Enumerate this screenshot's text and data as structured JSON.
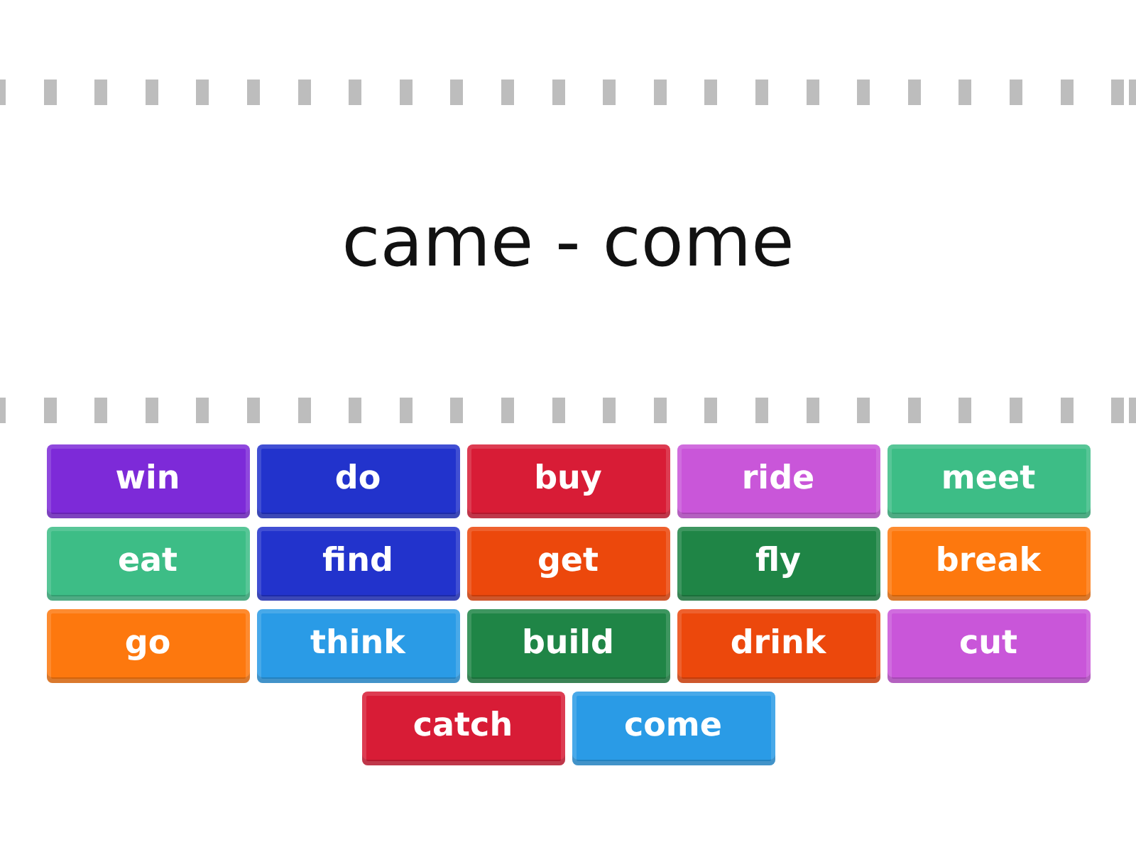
{
  "prompt": {
    "text": "came - come"
  },
  "answers": [
    {
      "label": "win",
      "color": "#7d2ad8"
    },
    {
      "label": "do",
      "color": "#2233cc"
    },
    {
      "label": "buy",
      "color": "#d81c36"
    },
    {
      "label": "ride",
      "color": "#c956d9"
    },
    {
      "label": "meet",
      "color": "#3dbd86"
    },
    {
      "label": "eat",
      "color": "#3dbd86"
    },
    {
      "label": "find",
      "color": "#2233cc"
    },
    {
      "label": "get",
      "color": "#ec480c"
    },
    {
      "label": "fly",
      "color": "#1f8546"
    },
    {
      "label": "break",
      "color": "#fd780e"
    },
    {
      "label": "go",
      "color": "#fd780e"
    },
    {
      "label": "think",
      "color": "#2a9be6"
    },
    {
      "label": "build",
      "color": "#1f8546"
    },
    {
      "label": "drink",
      "color": "#ec480c"
    },
    {
      "label": "cut",
      "color": "#c956d9"
    },
    {
      "label": "catch",
      "color": "#d81c36"
    },
    {
      "label": "come",
      "color": "#2a9be6"
    }
  ]
}
